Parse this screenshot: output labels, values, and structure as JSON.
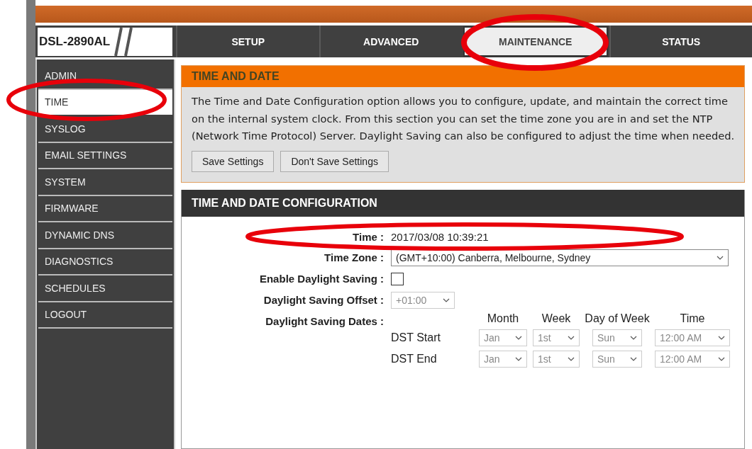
{
  "logo": {
    "text": "DSL-2890AL"
  },
  "tabs": [
    {
      "label": "SETUP",
      "selected": false
    },
    {
      "label": "ADVANCED",
      "selected": false
    },
    {
      "label": "MAINTENANCE",
      "selected": true
    },
    {
      "label": "STATUS",
      "selected": false
    }
  ],
  "sidebar": {
    "items": [
      {
        "label": "ADMIN",
        "selected": false
      },
      {
        "label": "TIME",
        "selected": true
      },
      {
        "label": "SYSLOG",
        "selected": false
      },
      {
        "label": "EMAIL SETTINGS",
        "selected": false
      },
      {
        "label": "SYSTEM",
        "selected": false
      },
      {
        "label": "FIRMWARE",
        "selected": false
      },
      {
        "label": "DYNAMIC DNS",
        "selected": false
      },
      {
        "label": "DIAGNOSTICS",
        "selected": false
      },
      {
        "label": "SCHEDULES",
        "selected": false
      },
      {
        "label": "LOGOUT",
        "selected": false
      }
    ]
  },
  "intro": {
    "title": "TIME AND DATE",
    "text": "The Time and Date Configuration option allows you to configure, update, and maintain the correct time on the internal system clock. From this section you can set the time zone you are in and set the NTP (Network Time Protocol) Server. Daylight Saving can also be configured to adjust the time when needed.",
    "buttons": [
      "Save Settings",
      "Don't Save Settings"
    ]
  },
  "config": {
    "title": "TIME AND DATE CONFIGURATION",
    "time": {
      "label": "Time :",
      "value": "2017/03/08 10:39:21"
    },
    "time_zone": {
      "label": "Time Zone :",
      "value": "(GMT+10:00) Canberra, Melbourne, Sydney",
      "disabled": false
    },
    "daylight_saving": {
      "label": "Enable Daylight Saving :",
      "checked": false
    },
    "offset": {
      "label": "Daylight Saving Offset :",
      "value": "+01:00",
      "disabled": true
    },
    "dates": {
      "label": "Daylight Saving Dates :",
      "columns": [
        "Month",
        "Week",
        "Day of Week",
        "Time"
      ],
      "rows": [
        {
          "label": "DST Start",
          "values": [
            "Jan",
            "1st",
            "Sun",
            "12:00 AM"
          ],
          "disabled": true
        },
        {
          "label": "DST End",
          "values": [
            "Jan",
            "1st",
            "Sun",
            "12:00 AM"
          ],
          "disabled": true
        }
      ]
    }
  }
}
